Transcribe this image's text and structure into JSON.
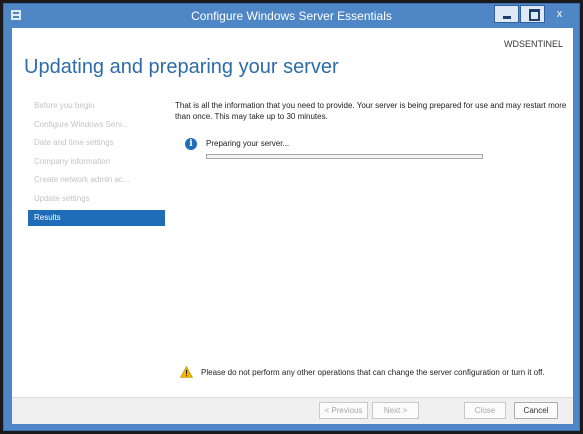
{
  "window": {
    "title": "Configure Windows Server Essentials",
    "close_glyph": "x",
    "accent_color": "#4f86c6"
  },
  "header": {
    "server_name": "WDSENTINEL",
    "page_title": "Updating and preparing your server"
  },
  "sidebar": {
    "items": [
      {
        "label": "Before you begin",
        "active": false
      },
      {
        "label": "Configure Windows Serv...",
        "active": false
      },
      {
        "label": "Date and time settings",
        "active": false
      },
      {
        "label": "Company information",
        "active": false
      },
      {
        "label": "Create network admin ac...",
        "active": false
      },
      {
        "label": "Update settings",
        "active": false
      },
      {
        "label": "Results",
        "active": true
      }
    ],
    "active_color": "#1f6cb8"
  },
  "main": {
    "intro": "That is all the information that you need to provide. Your server is being prepared for use and may restart more than once. This may take up to 30 minutes.",
    "status_text": "Preparing your server...",
    "progress_fraction": 0,
    "info_icon": "info-icon",
    "info_glyph": "i"
  },
  "warning": {
    "icon": "warning-icon",
    "text": "Please do not perform any other operations that can change the server configuration or turn it off."
  },
  "footer": {
    "previous_label": "< Previous",
    "next_label": "Next >",
    "close_label": "Close",
    "cancel_label": "Cancel"
  }
}
